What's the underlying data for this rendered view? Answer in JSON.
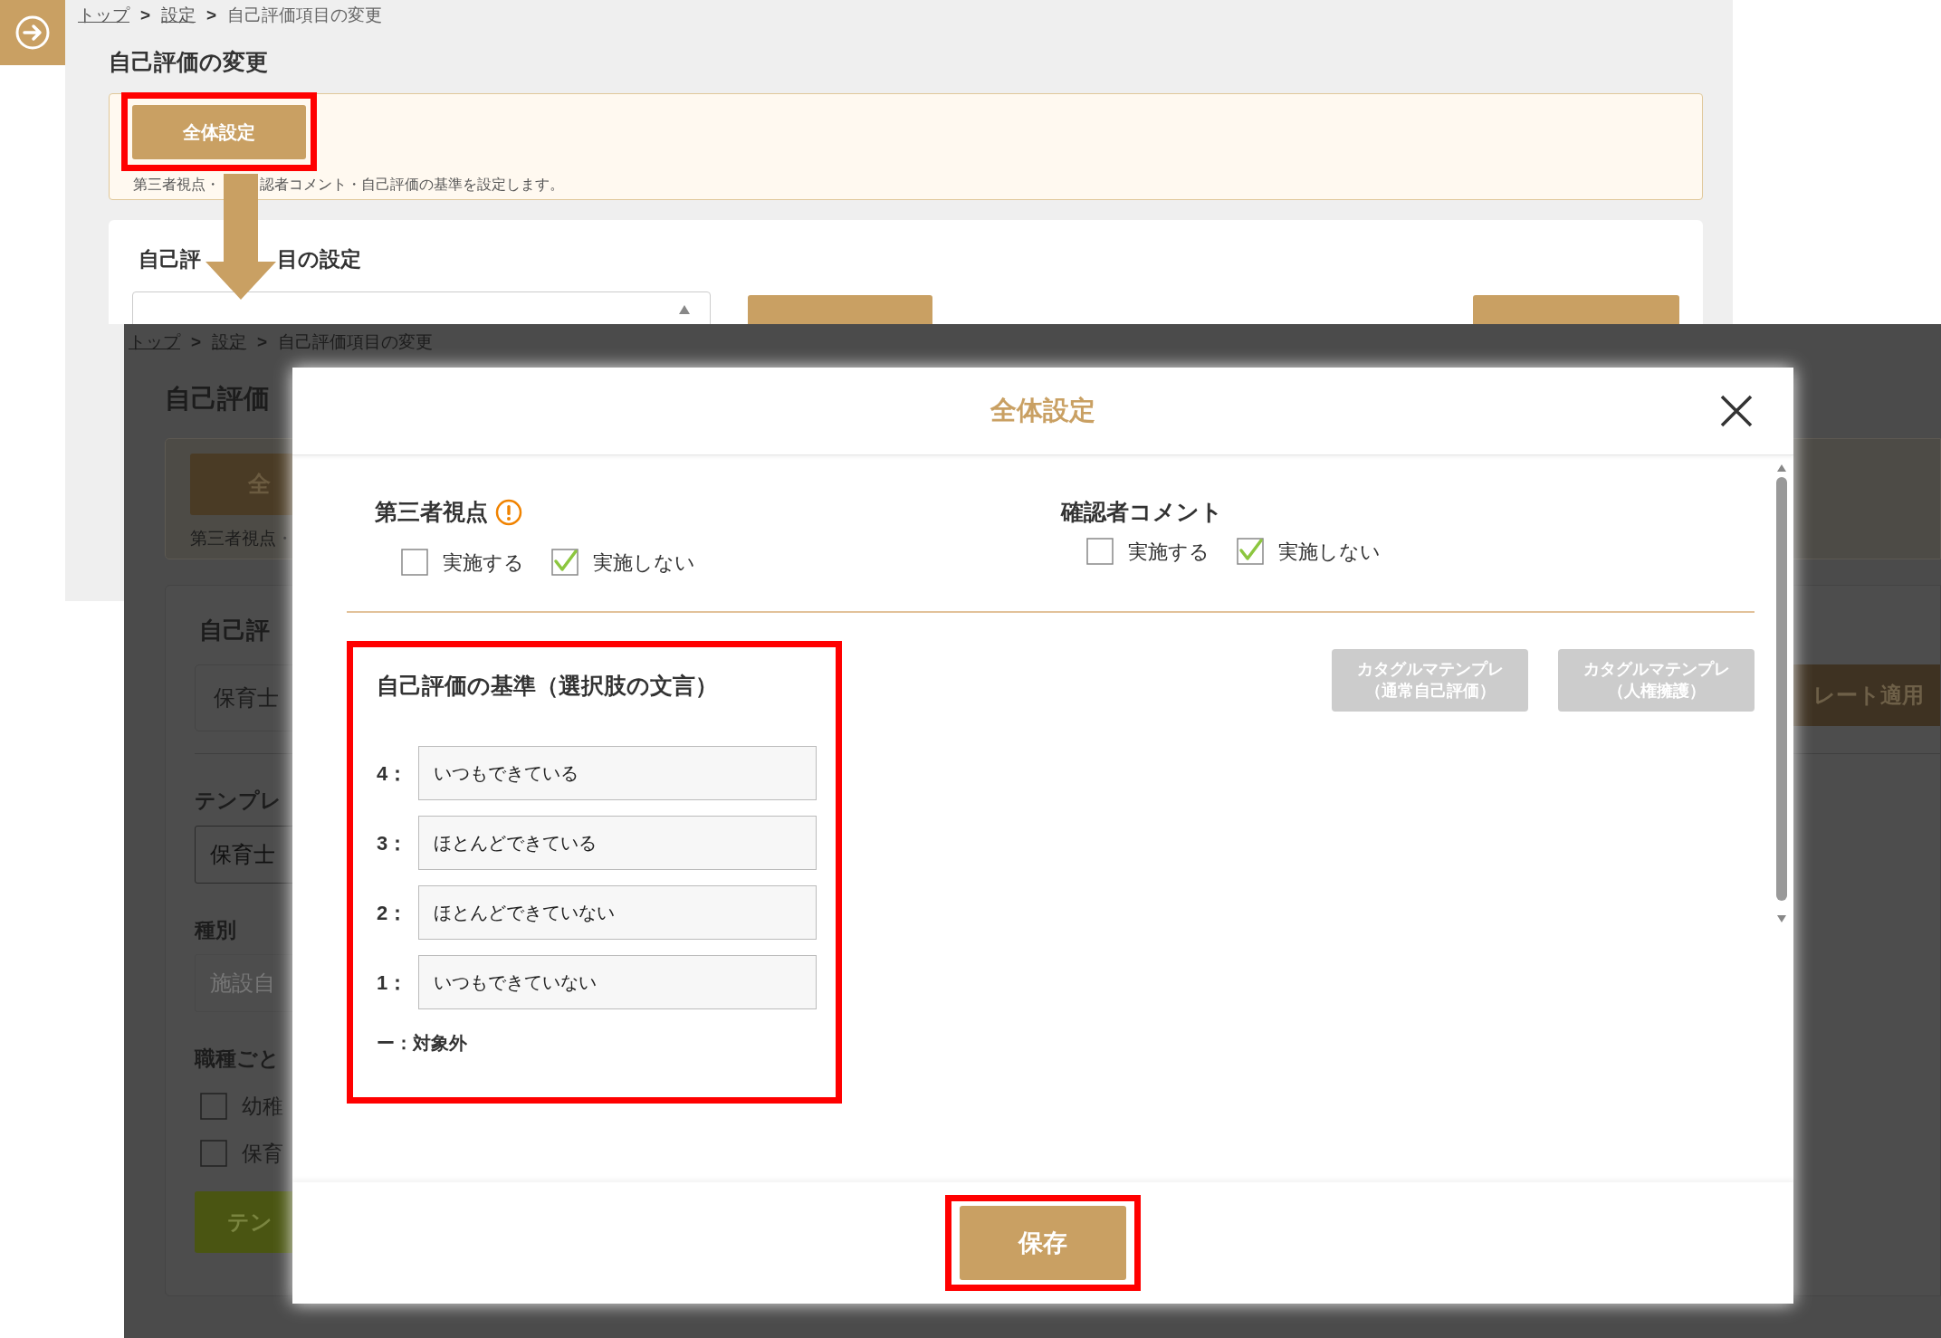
{
  "top_screenshot": {
    "breadcrumb": [
      {
        "kind": "link",
        "text": "トップ"
      },
      {
        "kind": "separator",
        "text": ">"
      },
      {
        "kind": "link",
        "text": "設定"
      },
      {
        "kind": "separator",
        "text": ">"
      },
      {
        "kind": "current",
        "text": "自己評価項目の変更"
      }
    ],
    "title": "自己評価の変更",
    "overall_settings": {
      "button": "全体設定",
      "description_parts": [
        "第三者視点・",
        "認者コメント・自己評価の基準を設定します。"
      ]
    },
    "item_settings": {
      "heading_parts": [
        "自己評",
        "目の設定"
      ]
    }
  },
  "dimmed_screenshot": {
    "breadcrumb": [
      {
        "kind": "link",
        "text": "トップ"
      },
      {
        "kind": "separator",
        "text": ">"
      },
      {
        "kind": "link",
        "text": "設定"
      },
      {
        "kind": "separator",
        "text": ">"
      },
      {
        "kind": "current",
        "text": "自己評価項目の変更"
      }
    ],
    "title": "自己評価",
    "overall_settings": {
      "button": "全",
      "description": "第三者視点・"
    },
    "item_settings": {
      "heading": "自己評",
      "template_select": "保育士",
      "status_button": "レート適用"
    },
    "fields": [
      {
        "label": "テンプレ",
        "value": "保育士"
      },
      {
        "label": "種別",
        "placeholder": "施設自"
      }
    ],
    "job_types": {
      "label": "職種ごと",
      "options": [
        {
          "label": "幼稚",
          "checked": false
        },
        {
          "label": "保育",
          "checked": false
        }
      ]
    },
    "apply_button": "テン"
  },
  "modal": {
    "title": "全体設定",
    "third_party": {
      "label": "第三者視点",
      "warning": true,
      "options": [
        {
          "label": "実施する",
          "checked": false
        },
        {
          "label": "実施しない",
          "checked": true
        }
      ]
    },
    "reviewer_comment": {
      "label": "確認者コメント",
      "warning": false,
      "options": [
        {
          "label": "実施する",
          "checked": false
        },
        {
          "label": "実施しない",
          "checked": true
        }
      ]
    },
    "criteria": {
      "heading": "自己評価の基準（選択肢の文言）",
      "levels": [
        {
          "label": "4：",
          "value": "いつもできている"
        },
        {
          "label": "3：",
          "value": "ほとんどできている"
        },
        {
          "label": "2：",
          "value": "ほとんどできていない"
        },
        {
          "label": "1：",
          "value": "いつもできていない"
        }
      ],
      "excluded": {
        "label": "ー：",
        "text": "対象外"
      }
    },
    "template_buttons": [
      {
        "lines": [
          "カタグルマテンプレ",
          "（通常自己評価）"
        ],
        "disabled": true
      },
      {
        "lines": [
          "カタグルマテンプレ",
          "（人権擁護）"
        ],
        "disabled": true
      }
    ],
    "save_button": "保存"
  }
}
